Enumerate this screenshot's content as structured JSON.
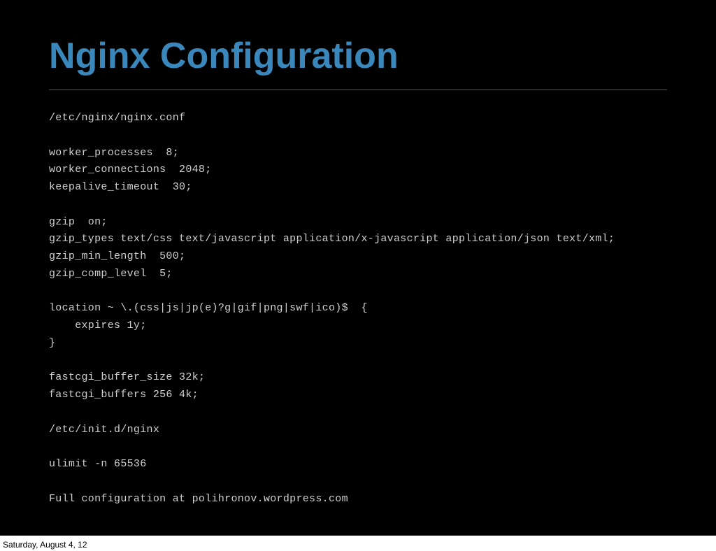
{
  "slide": {
    "title": "Nginx Configuration",
    "code_lines": [
      "/etc/nginx/nginx.conf",
      "",
      "worker_processes  8;",
      "worker_connections  2048;",
      "keepalive_timeout  30;",
      "",
      "gzip  on;",
      "gzip_types text/css text/javascript application/x-javascript application/json text/xml;",
      "gzip_min_length  500;",
      "gzip_comp_level  5;",
      "",
      "location ~ \\.(css|js|jp(e)?g|gif|png|swf|ico)$  {",
      "    expires 1y;",
      "}",
      "",
      "fastcgi_buffer_size 32k;",
      "fastcgi_buffers 256 4k;",
      "",
      "/etc/init.d/nginx",
      "",
      "ulimit -n 65536",
      "",
      "Full configuration at polihronov.wordpress.com"
    ]
  },
  "footer": {
    "date": "Saturday, August 4, 12"
  }
}
